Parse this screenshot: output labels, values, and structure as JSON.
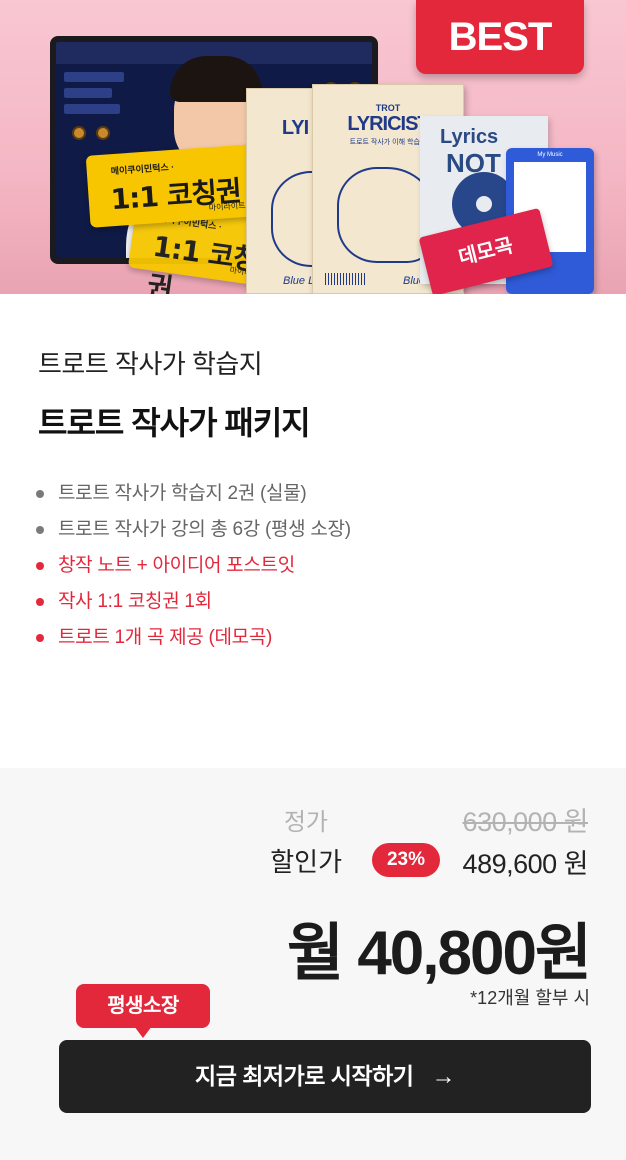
{
  "hero": {
    "badge": "BEST",
    "ticket": {
      "small": "메이쿠이민턱스 ·",
      "big": "1:1 코칭권",
      "tiny": "마이라이트"
    },
    "book": {
      "trot": "TROT",
      "title": "LYRICIST",
      "back_title": "LYI",
      "sub": "트로트 작사가 이해 학습지",
      "label": "Blue Label"
    },
    "notebook": {
      "line1": "Lyrics",
      "line2": "NOT"
    },
    "phone_header": "My Music",
    "demo_tag": "데모곡"
  },
  "product": {
    "subtitle": "트로트 작사가 학습지",
    "title": "트로트 작사가 패키지",
    "features": [
      {
        "text": "트로트 작사가 학습지 2권 (실물)",
        "highlight": false
      },
      {
        "text": "트로트 작사가 강의 총 6강 (평생 소장)",
        "highlight": false
      },
      {
        "text": "창작 노트 + 아이디어 포스트잇",
        "highlight": true
      },
      {
        "text": "작사 1:1 코칭권 1회",
        "highlight": true
      },
      {
        "text": "트로트 1개 곡 제공 (데모곡)",
        "highlight": true
      }
    ]
  },
  "pricing": {
    "regular_label": "정가",
    "regular_price": "630,000 원",
    "sale_label": "할인가",
    "discount": "23%",
    "sale_price": "489,600 원",
    "monthly": "월 40,800원",
    "installment_note": "*12개월 할부 시",
    "lifetime_badge": "평생소장",
    "cta_label": "지금 최저가로 시작하기",
    "cta_arrow": "→"
  },
  "colors": {
    "accent": "#e3283c",
    "hero_bg": "#f4b6c4",
    "cta_bg": "#222222",
    "price_bg": "#f7f7f7"
  }
}
